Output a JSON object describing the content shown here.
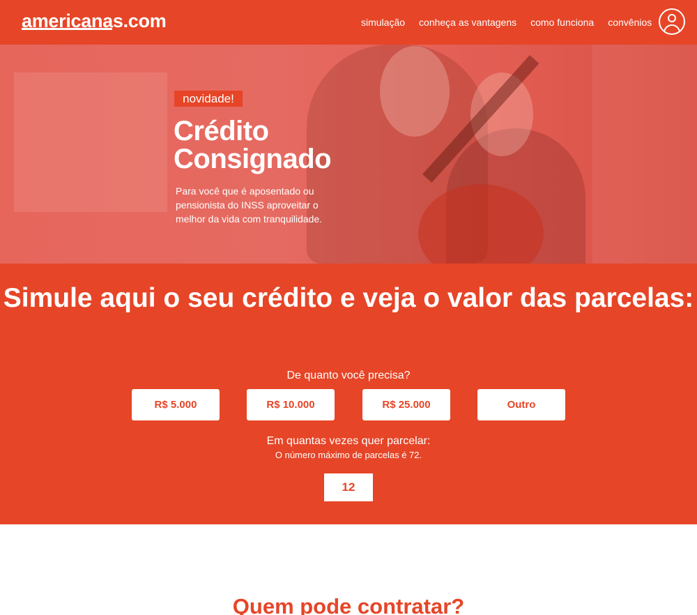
{
  "header": {
    "logo": "americanas.com",
    "nav": [
      "simulação",
      "conheça as vantagens",
      "como funciona",
      "convênios"
    ],
    "account_icon": "user-icon"
  },
  "hero": {
    "badge": "novidade!",
    "title_line1": "Crédito",
    "title_line2": "Consignado",
    "subtitle": "Para você que é aposentado ou pensionista do INSS aproveitar o melhor da vida com tranquilidade."
  },
  "simulator": {
    "title": "Simule aqui o seu crédito e veja o valor das parcelas:",
    "amount_question": "De quanto você precisa?",
    "amounts": [
      "R$ 5.000",
      "R$ 10.000",
      "R$ 25.000",
      "Outro"
    ],
    "installments_question": "Em quantas vezes quer parcelar:",
    "installments_note": "O número máximo de parcelas é 72.",
    "installments_value": "12"
  },
  "next_section": {
    "title": "Quem pode contratar?"
  },
  "colors": {
    "brand": "#e64527",
    "white": "#ffffff"
  }
}
